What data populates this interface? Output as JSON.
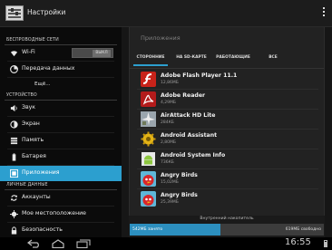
{
  "actionbar": {
    "title": "Настройки"
  },
  "sidebar": {
    "sections": [
      {
        "header": "БЕСПРОВОДНЫЕ СЕТИ"
      },
      {
        "header": "УСТРОЙСТВО"
      },
      {
        "header": "ЛИЧНЫЕ ДАННЫЕ"
      }
    ],
    "items": [
      {
        "label": "Wi-Fi",
        "icon": "wifi-icon"
      },
      {
        "label": "Передача данных",
        "icon": "data-usage-icon"
      },
      {
        "label": "Ещё...",
        "icon": ""
      },
      {
        "label": "Звук",
        "icon": "speaker-icon"
      },
      {
        "label": "Экран",
        "icon": "brightness-icon"
      },
      {
        "label": "Память",
        "icon": "storage-icon"
      },
      {
        "label": "Батарея",
        "icon": "battery-icon"
      },
      {
        "label": "Приложения",
        "icon": "apps-icon"
      },
      {
        "label": "Аккаунты",
        "icon": "sync-icon"
      },
      {
        "label": "Мое местоположение",
        "icon": "location-icon"
      },
      {
        "label": "Безопасность",
        "icon": "lock-icon"
      }
    ],
    "selected_index": 7,
    "wifi_toggle": "ВЫКЛ"
  },
  "apps_panel": {
    "title": "Приложения",
    "tabs": [
      "СТОРОННИЕ",
      "НА SD-КАРТЕ",
      "РАБОТАЮЩИЕ",
      "ВСЕ"
    ],
    "active_tab": 0,
    "apps": [
      {
        "name": "Adobe Flash Player 11.1",
        "size": "12,86МБ",
        "icon": "flash-player-icon"
      },
      {
        "name": "Adobe Reader",
        "size": "4,29МБ",
        "icon": "adobe-reader-icon"
      },
      {
        "name": "AirAttack HD Lite",
        "size": "284КБ",
        "icon": "airattack-icon"
      },
      {
        "name": "Android Assistant",
        "size": "2,80МБ",
        "icon": "android-assistant-icon"
      },
      {
        "name": "Android System Info",
        "size": "736КБ",
        "icon": "android-system-info-icon"
      },
      {
        "name": "Angry Birds",
        "size": "15,02МБ",
        "icon": "angry-birds-icon"
      },
      {
        "name": "Angry Birds",
        "size": "25,39МБ",
        "icon": "angry-birds-icon"
      }
    ],
    "storage": {
      "label": "Внутренний накопитель",
      "used": "542МБ занято",
      "free": "619МБ свободно",
      "used_fraction": 0.467
    }
  },
  "statusbar": {
    "time": "16:55"
  },
  "colors": {
    "accent": "#2c9fcf",
    "background": "#0b0b0b"
  }
}
